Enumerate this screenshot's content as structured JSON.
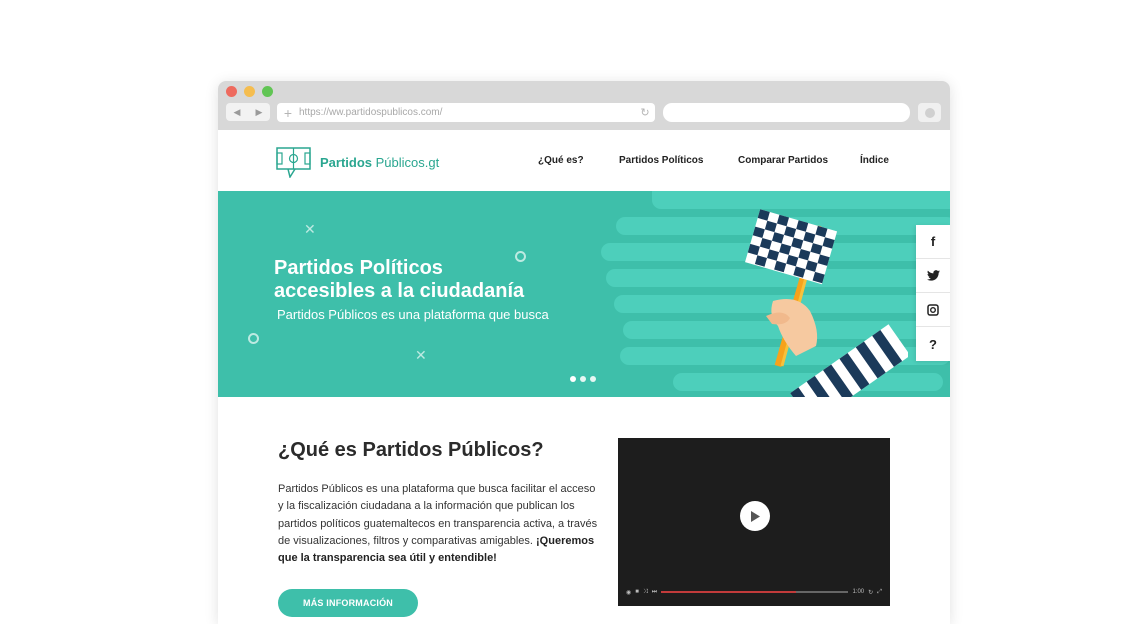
{
  "browser": {
    "url": "https://ww.partidospublicos.com/",
    "back_label": "◀",
    "forward_label": "▶"
  },
  "site": {
    "logo_bold": "Partidos",
    "logo_rest": " Públicos.gt",
    "nav": [
      "¿Qué es?",
      "Partidos Políticos",
      "Comparar Partidos",
      "Índice"
    ],
    "accent_color": "#3ebfaa"
  },
  "hero": {
    "title_line1": "Partidos Políticos",
    "title_line2": "accesibles a la ciudadanía",
    "subtitle": "Partidos Públicos es una plataforma que busca",
    "slides": 3,
    "active_slide": 1
  },
  "social": {
    "facebook": "f",
    "help": "?",
    "icons": [
      "facebook-icon",
      "twitter-icon",
      "instagram-icon",
      "help-icon"
    ]
  },
  "about": {
    "title": "¿Qué es Partidos Públicos?",
    "text": "Partidos Públicos es una plataforma que busca facilitar el acceso y la fiscalización ciudadana a la información que publican los partidos políticos guatemaltecos en transparencia activa, a través de visualizaciones, filtros y comparativas amigables.",
    "text_bold": "¡Queremos que la transparencia sea útil y entendible!",
    "button": "MÁS INFORMACIÓN"
  },
  "video": {
    "time": "1:00",
    "progress": 0.72
  }
}
